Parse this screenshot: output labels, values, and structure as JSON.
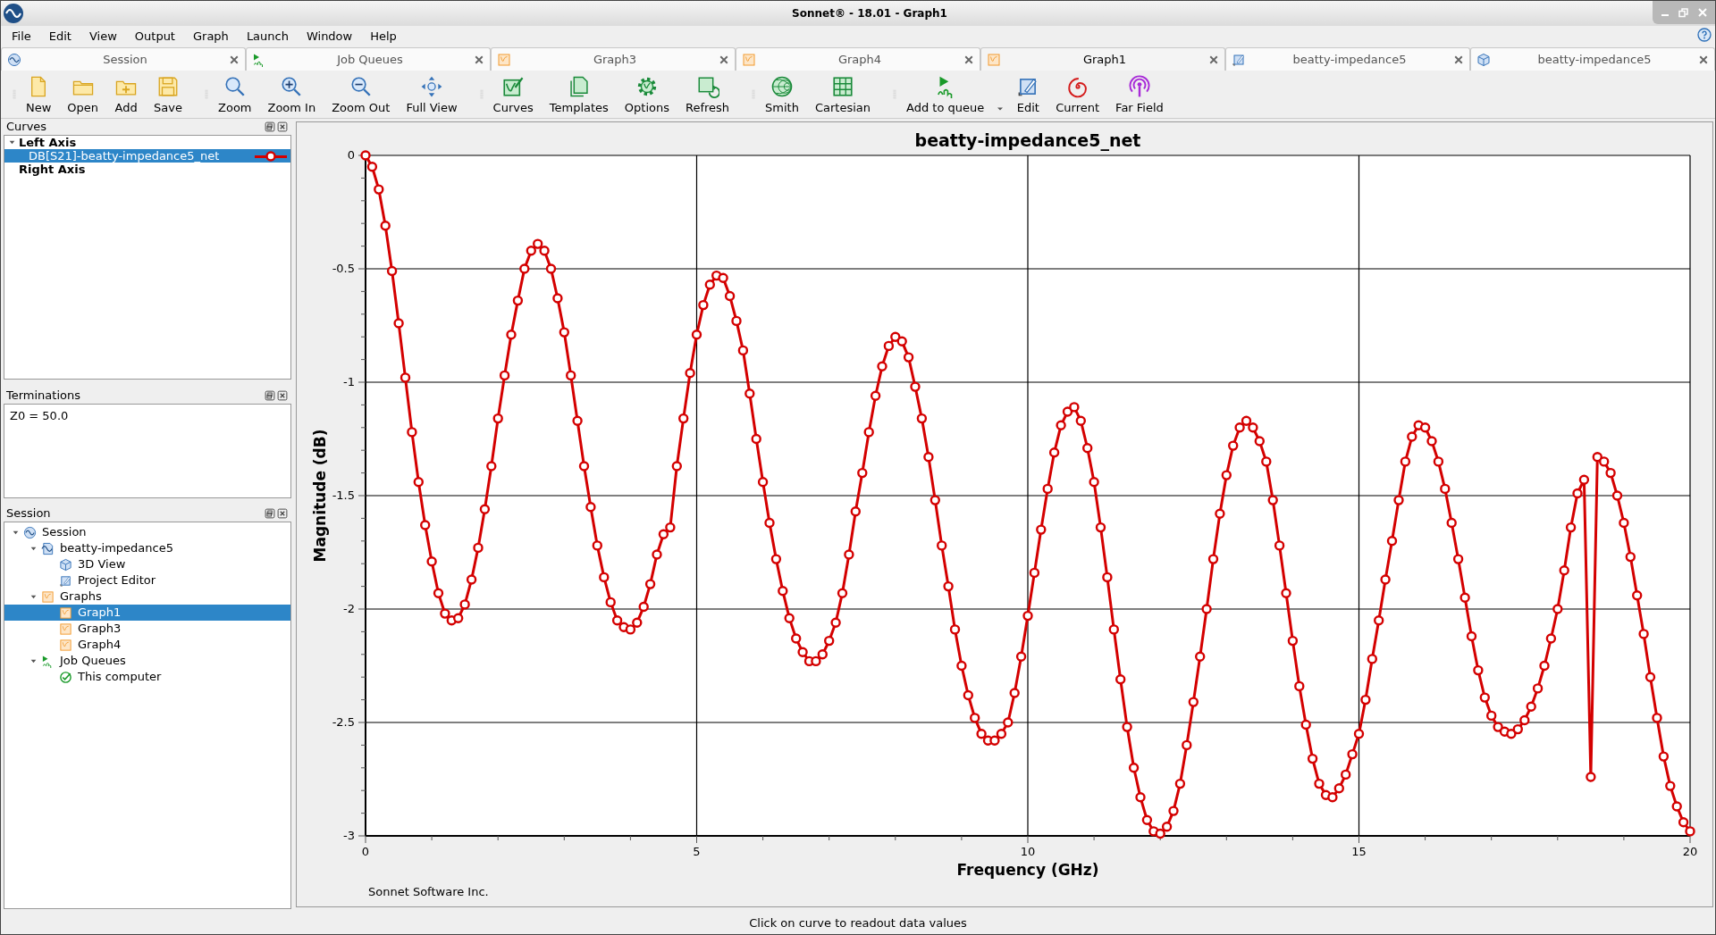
{
  "window": {
    "title": "Sonnet® - 18.01 - Graph1"
  },
  "menu": [
    "File",
    "Edit",
    "View",
    "Output",
    "Graph",
    "Launch",
    "Window",
    "Help"
  ],
  "tabs": [
    {
      "label": "Session",
      "kind": "session",
      "selected": false
    },
    {
      "label": "Job Queues",
      "kind": "em",
      "selected": false
    },
    {
      "label": "Graph3",
      "kind": "graph",
      "selected": false
    },
    {
      "label": "Graph4",
      "kind": "graph",
      "selected": false
    },
    {
      "label": "Graph1",
      "kind": "graph",
      "selected": true
    },
    {
      "label": "beatty-impedance5",
      "kind": "edit",
      "selected": false
    },
    {
      "label": "beatty-impedance5",
      "kind": "cube",
      "selected": false
    }
  ],
  "toolbar": [
    [
      {
        "label": "New",
        "kind": "new"
      },
      {
        "label": "Open",
        "kind": "open"
      },
      {
        "label": "Add",
        "kind": "add"
      },
      {
        "label": "Save",
        "kind": "save"
      }
    ],
    [
      {
        "label": "Zoom",
        "kind": "zoom"
      },
      {
        "label": "Zoom In",
        "kind": "zoomin"
      },
      {
        "label": "Zoom Out",
        "kind": "zoomout"
      },
      {
        "label": "Full View",
        "kind": "fullview"
      }
    ],
    [
      {
        "label": "Curves",
        "kind": "curves"
      },
      {
        "label": "Templates",
        "kind": "templates"
      },
      {
        "label": "Options",
        "kind": "options"
      },
      {
        "label": "Refresh",
        "kind": "refresh"
      }
    ],
    [
      {
        "label": "Smith",
        "kind": "smith"
      },
      {
        "label": "Cartesian",
        "kind": "cartesian"
      }
    ],
    [
      {
        "label": "Add to queue",
        "kind": "queue"
      },
      {
        "label": "Edit",
        "kind": "edit"
      },
      {
        "label": "Current",
        "kind": "current"
      },
      {
        "label": "Far Field",
        "kind": "farfield"
      }
    ]
  ],
  "curves_panel": {
    "title": "Curves",
    "items": [
      {
        "label": "Left Axis",
        "expanded": true,
        "selected": false,
        "children": [
          {
            "label": "DB[S21]-beatty-impedance5_net",
            "selected": true,
            "color": "#d40000"
          }
        ]
      },
      {
        "label": "Right Axis",
        "selected": false
      }
    ]
  },
  "terminations_panel": {
    "title": "Terminations",
    "text": "Z0 = 50.0"
  },
  "session_panel": {
    "title": "Session",
    "items": [
      {
        "label": "Session",
        "kind": "session",
        "expanded": true,
        "selected": false,
        "children": [
          {
            "label": "beatty-impedance5",
            "kind": "project",
            "expanded": true,
            "selected": false,
            "children": [
              {
                "label": "3D View",
                "kind": "cube",
                "selected": false
              },
              {
                "label": "Project Editor",
                "kind": "edit",
                "selected": false
              }
            ]
          },
          {
            "label": "Graphs",
            "kind": "graph",
            "expanded": true,
            "selected": false,
            "children": [
              {
                "label": "Graph1",
                "kind": "graph",
                "selected": true
              },
              {
                "label": "Graph3",
                "kind": "graph",
                "selected": false
              },
              {
                "label": "Graph4",
                "kind": "graph",
                "selected": false
              }
            ]
          },
          {
            "label": "Job Queues",
            "kind": "em",
            "expanded": true,
            "selected": false,
            "children": [
              {
                "label": "This computer",
                "kind": "check",
                "selected": false
              }
            ]
          }
        ]
      }
    ]
  },
  "graph": {
    "footer": "Sonnet Software Inc.",
    "chart_data": {
      "type": "line",
      "title": "beatty-impedance5_net",
      "xlabel": "Frequency (GHz)",
      "ylabel": "Magnitude (dB)",
      "xlim": [
        0,
        20
      ],
      "ylim": [
        -3,
        0
      ],
      "xticks": [
        0,
        5,
        10,
        15,
        20
      ],
      "yticks": [
        {
          "value": 0,
          "label": "0"
        },
        {
          "value": -0.5,
          "label": "-0.5"
        },
        {
          "value": -1,
          "label": "-1"
        },
        {
          "value": -1.5,
          "label": "-1.5"
        },
        {
          "value": -2,
          "label": "-2"
        },
        {
          "value": -2.5,
          "label": "-2.5"
        },
        {
          "value": -3,
          "label": "-3"
        }
      ],
      "x": [
        0,
        0.1,
        0.2,
        0.3,
        0.4,
        0.5,
        0.6,
        0.7,
        0.8,
        0.9,
        1,
        1.1,
        1.2,
        1.3,
        1.4,
        1.5,
        1.6,
        1.7,
        1.8,
        1.9,
        2,
        2.1,
        2.2,
        2.3,
        2.4,
        2.5,
        2.6,
        2.7,
        2.8,
        2.9,
        3,
        3.1,
        3.2,
        3.3,
        3.4,
        3.5,
        3.6,
        3.7,
        3.8,
        3.9,
        4,
        4.1,
        4.2,
        4.3,
        4.4,
        4.5,
        4.6,
        4.7,
        4.8,
        4.9,
        5,
        5.1,
        5.2,
        5.3,
        5.4,
        5.5,
        5.6,
        5.7,
        5.8,
        5.9,
        6,
        6.1,
        6.2,
        6.3,
        6.4,
        6.5,
        6.6,
        6.7,
        6.8,
        6.9,
        7,
        7.1,
        7.2,
        7.3,
        7.4,
        7.5,
        7.6,
        7.7,
        7.8,
        7.9,
        8,
        8.1,
        8.2,
        8.3,
        8.4,
        8.5,
        8.6,
        8.7,
        8.8,
        8.9,
        9,
        9.1,
        9.2,
        9.3,
        9.4,
        9.5,
        9.6,
        9.7,
        9.8,
        9.9,
        10,
        10.1,
        10.2,
        10.3,
        10.4,
        10.5,
        10.6,
        10.7,
        10.8,
        10.9,
        11,
        11.1,
        11.2,
        11.3,
        11.4,
        11.5,
        11.6,
        11.7,
        11.8,
        11.9,
        12,
        12.1,
        12.2,
        12.3,
        12.4,
        12.5,
        12.6,
        12.7,
        12.8,
        12.9,
        13,
        13.1,
        13.2,
        13.3,
        13.4,
        13.5,
        13.6,
        13.7,
        13.8,
        13.9,
        14,
        14.1,
        14.2,
        14.3,
        14.4,
        14.5,
        14.6,
        14.7,
        14.8,
        14.9,
        15,
        15.1,
        15.2,
        15.3,
        15.4,
        15.5,
        15.6,
        15.7,
        15.8,
        15.9,
        16,
        16.1,
        16.2,
        16.3,
        16.4,
        16.5,
        16.6,
        16.7,
        16.8,
        16.9,
        17,
        17.1,
        17.2,
        17.3,
        17.4,
        17.5,
        17.6,
        17.7,
        17.8,
        17.9,
        18,
        18.1,
        18.2,
        18.3,
        18.4,
        18.5,
        18.6,
        18.7,
        18.8,
        18.9,
        19,
        19.1,
        19.2,
        19.3,
        19.4,
        19.5,
        19.6,
        19.7,
        19.8,
        19.9,
        20
      ],
      "grid": true,
      "series": [
        {
          "color": "#d40000",
          "marker": "circle",
          "values": [
            0,
            -0.05,
            -0.15,
            -0.31,
            -0.51,
            -0.74,
            -0.98,
            -1.22,
            -1.44,
            -1.63,
            -1.79,
            -1.93,
            -2.02,
            -2.05,
            -2.04,
            -1.98,
            -1.87,
            -1.73,
            -1.56,
            -1.37,
            -1.16,
            -0.97,
            -0.79,
            -0.64,
            -0.5,
            -0.42,
            -0.39,
            -0.42,
            -0.5,
            -0.63,
            -0.78,
            -0.97,
            -1.17,
            -1.37,
            -1.55,
            -1.72,
            -1.86,
            -1.97,
            -2.05,
            -2.08,
            -2.09,
            -2.06,
            -1.99,
            -1.89,
            -1.76,
            -1.67,
            -1.64,
            -1.37,
            -1.16,
            -0.96,
            -0.79,
            -0.66,
            -0.57,
            -0.53,
            -0.54,
            -0.62,
            -0.73,
            -0.86,
            -1.05,
            -1.25,
            -1.44,
            -1.62,
            -1.78,
            -1.92,
            -2.04,
            -2.13,
            -2.19,
            -2.23,
            -2.23,
            -2.2,
            -2.14,
            -2.06,
            -1.93,
            -1.76,
            -1.57,
            -1.4,
            -1.22,
            -1.06,
            -0.93,
            -0.84,
            -0.8,
            -0.82,
            -0.89,
            -1.02,
            -1.16,
            -1.33,
            -1.52,
            -1.72,
            -1.9,
            -2.09,
            -2.25,
            -2.38,
            -2.48,
            -2.55,
            -2.58,
            -2.58,
            -2.55,
            -2.5,
            -2.37,
            -2.21,
            -2.03,
            -1.84,
            -1.65,
            -1.47,
            -1.31,
            -1.19,
            -1.13,
            -1.11,
            -1.17,
            -1.29,
            -1.44,
            -1.64,
            -1.86,
            -2.09,
            -2.31,
            -2.52,
            -2.7,
            -2.83,
            -2.93,
            -2.98,
            -2.99,
            -2.96,
            -2.89,
            -2.77,
            -2.6,
            -2.41,
            -2.21,
            -2,
            -1.78,
            -1.58,
            -1.41,
            -1.28,
            -1.2,
            -1.17,
            -1.2,
            -1.26,
            -1.35,
            -1.52,
            -1.72,
            -1.93,
            -2.14,
            -2.34,
            -2.51,
            -2.66,
            -2.77,
            -2.82,
            -2.83,
            -2.79,
            -2.73,
            -2.64,
            -2.55,
            -2.4,
            -2.22,
            -2.05,
            -1.87,
            -1.7,
            -1.52,
            -1.35,
            -1.24,
            -1.19,
            -1.2,
            -1.26,
            -1.35,
            -1.47,
            -1.62,
            -1.78,
            -1.95,
            -2.12,
            -2.27,
            -2.39,
            -2.47,
            -2.52,
            -2.54,
            -2.55,
            -2.53,
            -2.49,
            -2.43,
            -2.35,
            -2.25,
            -2.13,
            -2,
            -1.83,
            -1.64,
            -1.49,
            -1.43,
            -2.74,
            -1.33,
            -1.35,
            -1.4,
            -1.5,
            -1.62,
            -1.77,
            -1.94,
            -2.11,
            -2.3,
            -2.48,
            -2.65,
            -2.78,
            -2.87,
            -2.94,
            -2.98
          ]
        }
      ]
    }
  },
  "status_bar": "Click on curve to readout data values"
}
